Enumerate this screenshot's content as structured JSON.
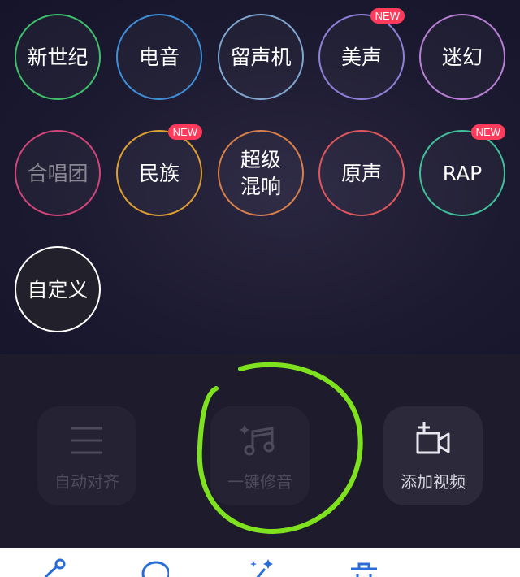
{
  "effects": [
    {
      "label": "新世纪",
      "color": "#3fbf6a",
      "badge": ""
    },
    {
      "label": "电音",
      "color": "#3f8fd8",
      "badge": ""
    },
    {
      "label": "留声机",
      "color": "#7fa6d0",
      "badge": ""
    },
    {
      "label": "美声",
      "color": "#8f7fd8",
      "badge": "NEW"
    },
    {
      "label": "迷幻",
      "color": "#b77fd4",
      "badge": ""
    },
    {
      "label": "合唱团",
      "color": "#d0457a",
      "badge": ""
    },
    {
      "label": "民族",
      "color": "#e0a030",
      "badge": "NEW"
    },
    {
      "label": "超级\n混响",
      "color": "#d8804a",
      "badge": ""
    },
    {
      "label": "原声",
      "color": "#e0565c",
      "badge": ""
    },
    {
      "label": "RAP",
      "color": "#3fbf9a",
      "badge": "NEW"
    },
    {
      "label": "自定义",
      "color": "#ffffff",
      "badge": ""
    }
  ],
  "tools": {
    "auto_align": {
      "label": "自动对齐",
      "state": "disabled"
    },
    "one_click_tune": {
      "label": "一键修音",
      "state": "disabled"
    },
    "add_video": {
      "label": "添加视频",
      "state": "enabled"
    }
  },
  "colors": {
    "annotation_green": "#7fe21f",
    "badge_red": "#ff3b5c"
  },
  "bottom_icons": [
    "share-icon",
    "tune-icon",
    "magic-wand-icon",
    "trash-icon",
    "more-icon"
  ]
}
